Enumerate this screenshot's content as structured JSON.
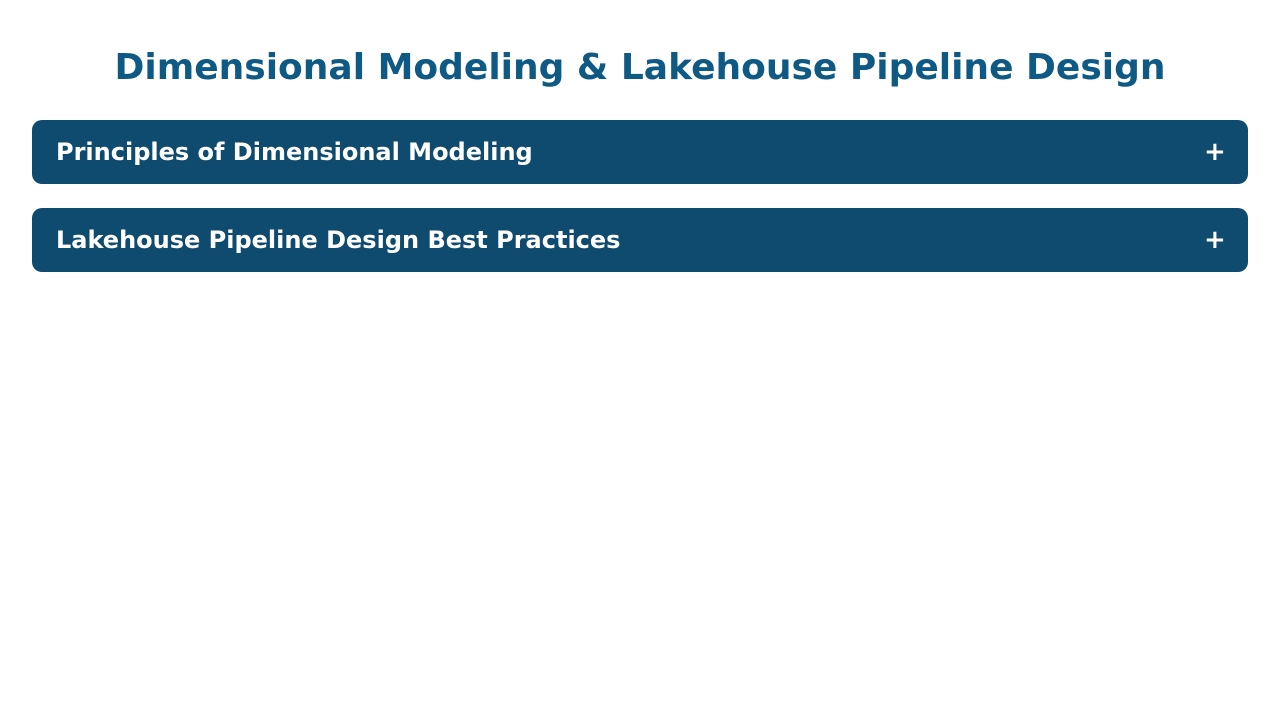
{
  "page": {
    "title": "Dimensional Modeling & Lakehouse Pipeline Design"
  },
  "accordion": {
    "items": [
      {
        "label": "Principles of Dimensional Modeling",
        "toggle_symbol": "+",
        "expanded": false
      },
      {
        "label": "Lakehouse Pipeline Design Best Practices",
        "toggle_symbol": "+",
        "expanded": false
      }
    ]
  },
  "colors": {
    "title": "#0e5a85",
    "header_background": "#0e4b6e",
    "header_text": "#ffffff",
    "page_background": "#ffffff"
  },
  "icons": {
    "toggle": "plus-icon"
  }
}
